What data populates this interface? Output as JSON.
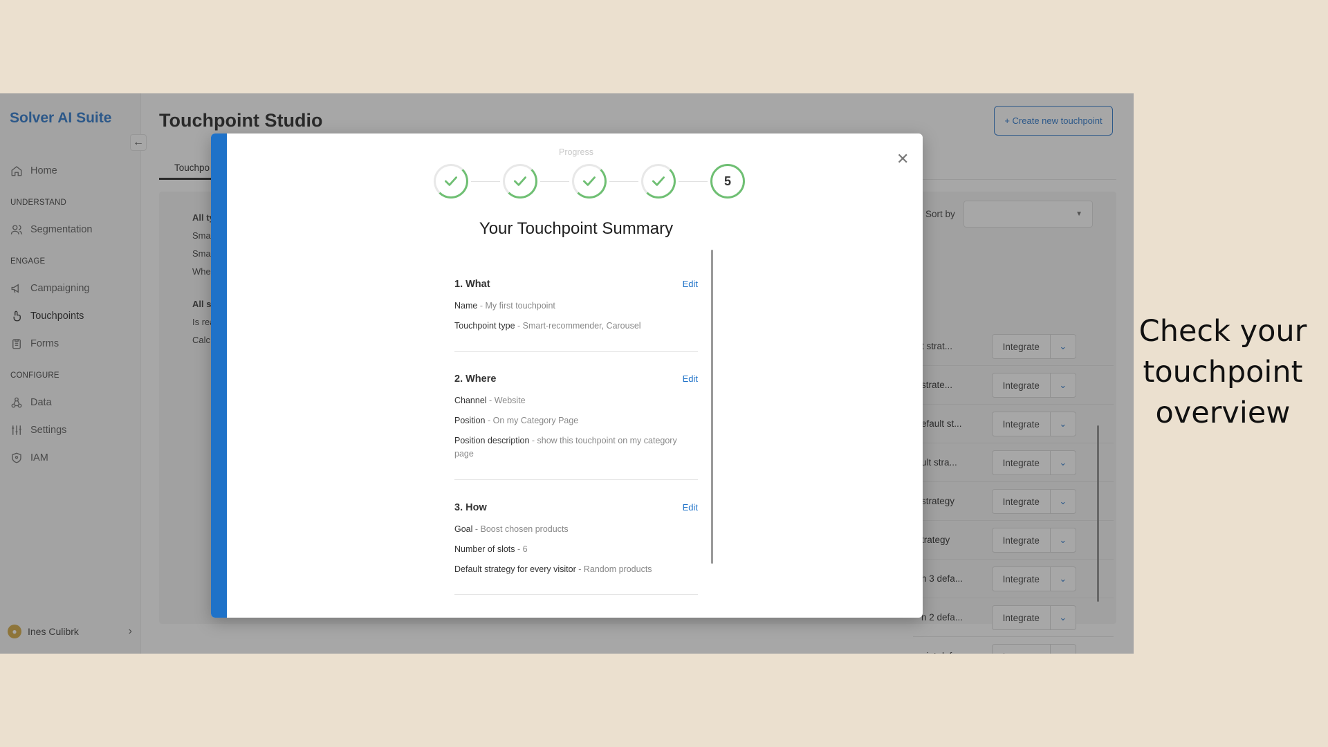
{
  "sidebar": {
    "brand": "Solver AI Suite",
    "home": "Home",
    "section_understand": "UNDERSTAND",
    "segmentation": "Segmentation",
    "section_engage": "ENGAGE",
    "campaigning": "Campaigning",
    "touchpoints": "Touchpoints",
    "forms": "Forms",
    "section_configure": "CONFIGURE",
    "data": "Data",
    "settings": "Settings",
    "iam": "IAM",
    "user_name": "Ines Culibrk"
  },
  "main": {
    "title": "Touchpoint Studio",
    "create_button": "+ Create new touchpoint",
    "tab_first": "Touchpo",
    "filters": [
      "All ty",
      "Sma",
      "Sma",
      "Whe",
      "All s",
      "Is rea",
      "Calc"
    ],
    "sort_label": "Sort by",
    "rows": [
      {
        "text": "t strat...",
        "action": "Integrate"
      },
      {
        "text": "strate...",
        "action": "Integrate"
      },
      {
        "text": "efault st...",
        "action": "Integrate"
      },
      {
        "text": "ult stra...",
        "action": "Integrate"
      },
      {
        "text": "strategy",
        "action": "Integrate"
      },
      {
        "text": "trategy",
        "action": "Integrate"
      },
      {
        "text": "h 3 defa...",
        "action": "Integrate"
      },
      {
        "text": "h 2 defa...",
        "action": "Integrate"
      },
      {
        "text": "oint defa...",
        "action": "Integrate"
      }
    ]
  },
  "modal": {
    "progress_label": "Progress",
    "final_step": "5",
    "title": "Your Touchpoint Summary",
    "edit_label": "Edit",
    "what": {
      "title": "1. What",
      "name_key": "Name",
      "name_val": "My first touchpoint",
      "type_key": "Touchpoint type",
      "type_val": "Smart-recommender, Carousel"
    },
    "where": {
      "title": "2. Where",
      "channel_key": "Channel",
      "channel_val": "Website",
      "position_key": "Position",
      "position_val": "On my Category Page",
      "desc_key": "Position description",
      "desc_val": "show this touchpoint on my category page"
    },
    "how": {
      "title": "3. How",
      "goal_key": "Goal",
      "goal_val": "Boost chosen products",
      "slots_key": "Number of slots",
      "slots_val": "6",
      "strategy_key": "Default strategy for every visitor",
      "strategy_val": "Random products"
    }
  },
  "caption": "Check your touchpoint overview",
  "colors": {
    "accent": "#1f72c8",
    "success": "#6fbf73",
    "background": "#ebe0cf"
  }
}
